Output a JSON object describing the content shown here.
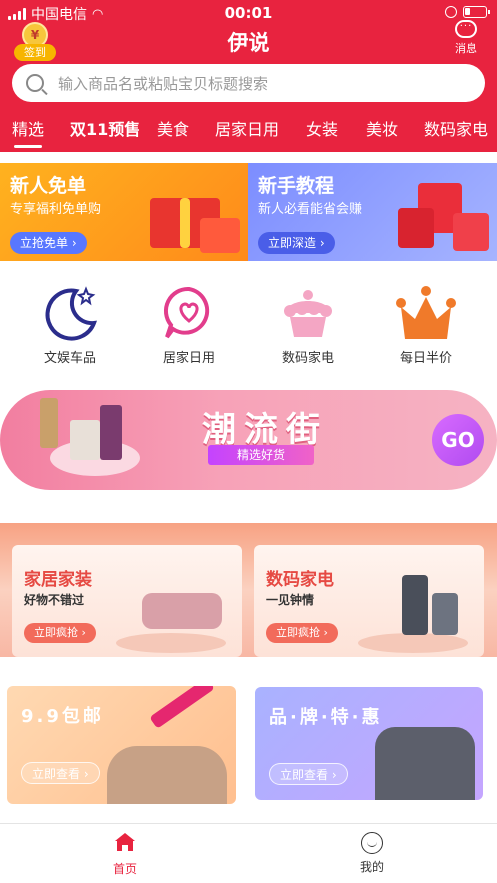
{
  "statusbar": {
    "carrier": "中国电信",
    "time": "00:01"
  },
  "header": {
    "title": "伊说",
    "signin_coin": "¥",
    "signin_label": "签到",
    "message_label": "消息",
    "search_placeholder": "输入商品名或粘贴宝贝标题搜索"
  },
  "tabs": [
    "精选",
    "双11预售",
    "美食",
    "居家日用",
    "女装",
    "美妆",
    "数码家电"
  ],
  "promos": [
    {
      "title": "新人免单",
      "subtitle": "专享福利免单购",
      "button": "立抢免单 ›"
    },
    {
      "title": "新手教程",
      "subtitle": "新人必看能省会赚",
      "button": "立即深造 ›"
    }
  ],
  "categories": [
    "文娱车品",
    "居家日用",
    "数码家电",
    "每日半价"
  ],
  "trend": {
    "title": "潮流街",
    "subtitle": "精选好货",
    "go": "GO"
  },
  "home_cards": [
    {
      "title": "家居家装",
      "subtitle": "好物不错过",
      "button": "立即疯抢 ›"
    },
    {
      "title": "数码家电",
      "subtitle": "一见钟情",
      "button": "立即疯抢 ›"
    }
  ],
  "bottom_cards": [
    {
      "title": "9.9包邮",
      "button": "立即查看 ›"
    },
    {
      "title": "品·牌·特·惠",
      "button": "立即查看 ›"
    }
  ],
  "tabbar": [
    "首页",
    "我的"
  ],
  "colors": {
    "brand": "#e8233f",
    "promo1": "#ff9a1f",
    "promo2": "#8796ff",
    "trend": "#f59ab2"
  }
}
